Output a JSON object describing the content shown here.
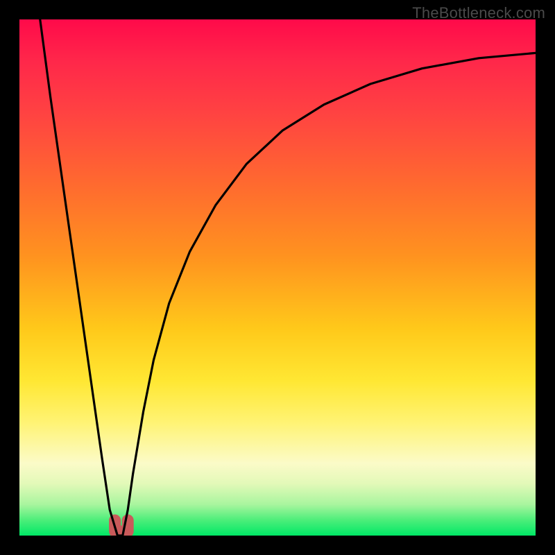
{
  "watermark": "TheBottleneck.com",
  "chart_data": {
    "type": "line",
    "title": "",
    "xlabel": "",
    "ylabel": "",
    "xlim": [
      0,
      100
    ],
    "ylim": [
      0,
      100
    ],
    "grid": false,
    "series": [
      {
        "name": "bottleneck-curve",
        "x": [
          4,
          6,
          8,
          10,
          12,
          14,
          16,
          17.5,
          19,
          20,
          21,
          22,
          24,
          26,
          29,
          33,
          38,
          44,
          51,
          59,
          68,
          78,
          89,
          100
        ],
        "y": [
          100,
          85,
          71,
          57,
          43,
          29,
          15,
          5,
          0,
          0,
          5,
          12,
          24,
          34,
          45,
          55,
          64,
          72,
          78.5,
          83.5,
          87.5,
          90.5,
          92.5,
          93.5
        ]
      }
    ],
    "marker": {
      "name": "bottom-marker",
      "color": "#c95a5a",
      "x_range": [
        18.5,
        21
      ],
      "y": 0
    },
    "background": {
      "type": "vertical-gradient",
      "stops": [
        {
          "pos": 0.0,
          "color": "#ff0a4a"
        },
        {
          "pos": 0.18,
          "color": "#ff4242"
        },
        {
          "pos": 0.46,
          "color": "#ff931f"
        },
        {
          "pos": 0.7,
          "color": "#ffe733"
        },
        {
          "pos": 0.86,
          "color": "#fbfbc8"
        },
        {
          "pos": 1.0,
          "color": "#00e866"
        }
      ]
    }
  }
}
